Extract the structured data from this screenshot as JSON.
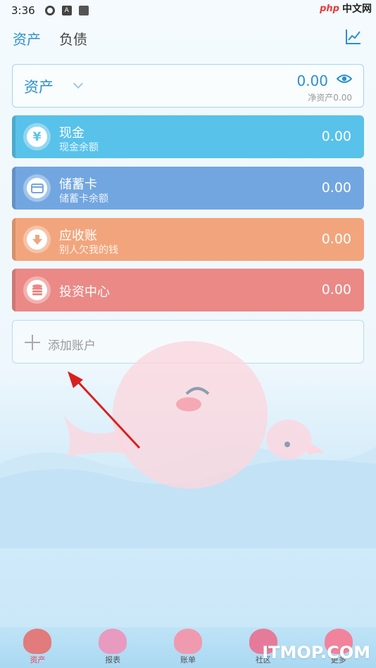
{
  "status_bar": {
    "time": "3:36",
    "badge_letter": "A",
    "brand_php": "php",
    "brand_cn": "中文网"
  },
  "top_nav": {
    "tabs": [
      {
        "label": "资产"
      },
      {
        "label": "负债"
      }
    ]
  },
  "summary": {
    "title": "资产",
    "amount": "0.00",
    "net_label": "净资产0.00"
  },
  "accounts": [
    {
      "name": "现金",
      "subtitle": "现金余额",
      "value": "0.00",
      "icon": "yen-icon",
      "color": "#58c2ea",
      "glyph": "¥"
    },
    {
      "name": "储蓄卡",
      "subtitle": "储蓄卡余额",
      "value": "0.00",
      "icon": "card-icon",
      "color": "#72a6e0",
      "glyph": "▭"
    },
    {
      "name": "应收账",
      "subtitle": "别人欠我的钱",
      "value": "0.00",
      "icon": "receivable-icon",
      "color": "#f2a57c",
      "glyph": "↓"
    },
    {
      "name": "投资中心",
      "subtitle": "",
      "value": "0.00",
      "icon": "coin-stack-icon",
      "color": "#eb8986",
      "glyph": "≡"
    }
  ],
  "add_account": {
    "label": "添加账户"
  },
  "bottom_tabs": [
    {
      "label": "资产",
      "icon": "shell-icon",
      "color": "#e27b7b"
    },
    {
      "label": "报表",
      "icon": "coral-icon",
      "color": "#e89ac0"
    },
    {
      "label": "账单",
      "icon": "fish-icon",
      "color": "#f09ab0"
    },
    {
      "label": "社区",
      "icon": "lantern-icon",
      "color": "#e67a9a"
    },
    {
      "label": "更多",
      "icon": "jellyfish-icon",
      "color": "#f2839c"
    }
  ],
  "watermark": "ITMOP.COM"
}
